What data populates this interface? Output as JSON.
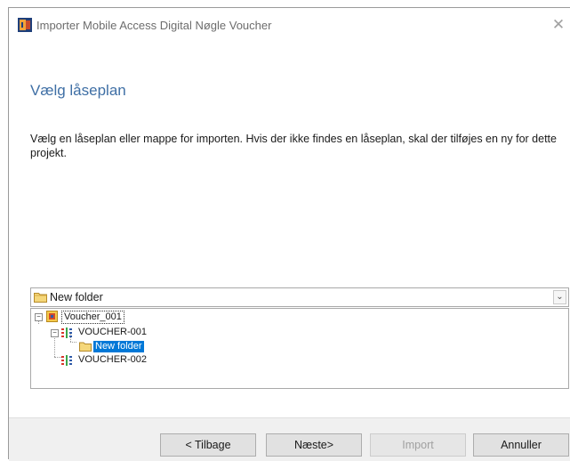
{
  "window": {
    "title": "Importer Mobile Access Digital Nøgle Voucher",
    "close_glyph": "✕"
  },
  "page": {
    "title": "Vælg låseplan",
    "description": "Vælg en låseplan eller mappe for importen. Hvis der ikke findes en låseplan, skal der tilføjes en ny for dette projekt."
  },
  "combo": {
    "selected": "New folder",
    "icon": "folder-icon"
  },
  "tree": {
    "root": {
      "label": "Voucher_001",
      "icon": "lock-plan-icon",
      "expanded": true
    },
    "children": [
      {
        "label": "VOUCHER-001",
        "icon": "grid-icon",
        "expanded": true,
        "children": [
          {
            "label": "New folder",
            "icon": "folder-icon",
            "selected": true
          }
        ]
      },
      {
        "label": "VOUCHER-002",
        "icon": "grid-icon"
      }
    ]
  },
  "buttons": {
    "back": "< Tilbage",
    "next": "Næste>",
    "import": "Import",
    "cancel": "Annuller"
  },
  "colors": {
    "title_accent": "#3f6fa5",
    "selection": "#0078d7"
  }
}
